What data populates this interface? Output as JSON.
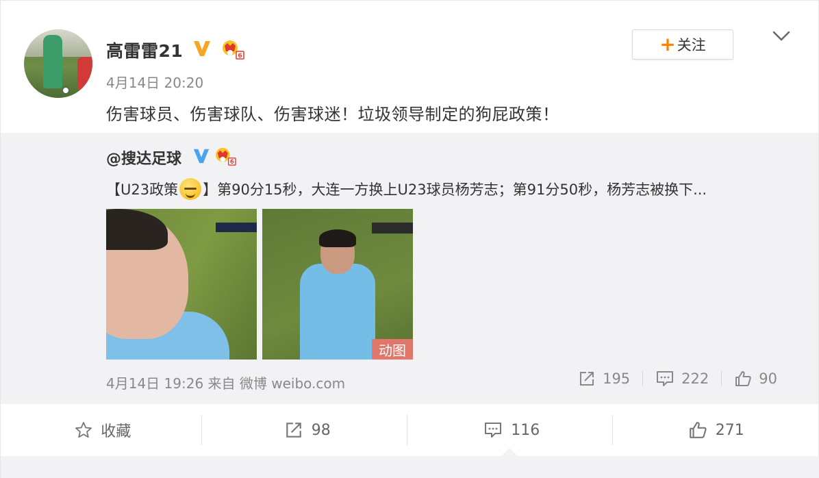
{
  "post": {
    "username": "高雷雷21",
    "time": "4月14日 20:20",
    "text": "伤害球员、伤害球队、伤害球迷！垃圾领导制定的狗屁政策！",
    "follow_label": "关注",
    "follow_plus": "+"
  },
  "retweet": {
    "username": "@搜达足球",
    "text_prefix": "【U23政策",
    "text_suffix": "】第90分15秒，大连一方换上U23球员杨芳志；第91分50秒，杨芳志被换下...",
    "gif_label": "动图",
    "meta": "4月14日 19:26 来自 微博 weibo.com",
    "shares": "195",
    "comments": "222",
    "likes": "90"
  },
  "actions": {
    "favorite_label": "收藏",
    "shares": "98",
    "comments": "116",
    "likes": "271"
  },
  "icons": {
    "verified": "verified-v-icon",
    "vip": "crown-icon",
    "more": "chevron-down-icon",
    "share": "share-icon",
    "comment": "comment-icon",
    "like": "thumbs-up-icon",
    "favorite": "star-icon"
  },
  "colors": {
    "verified_gold": "#f5a623",
    "verified_blue": "#4aa3ef",
    "follow_plus": "#ff8200",
    "gif_badge": "#e0776a"
  }
}
